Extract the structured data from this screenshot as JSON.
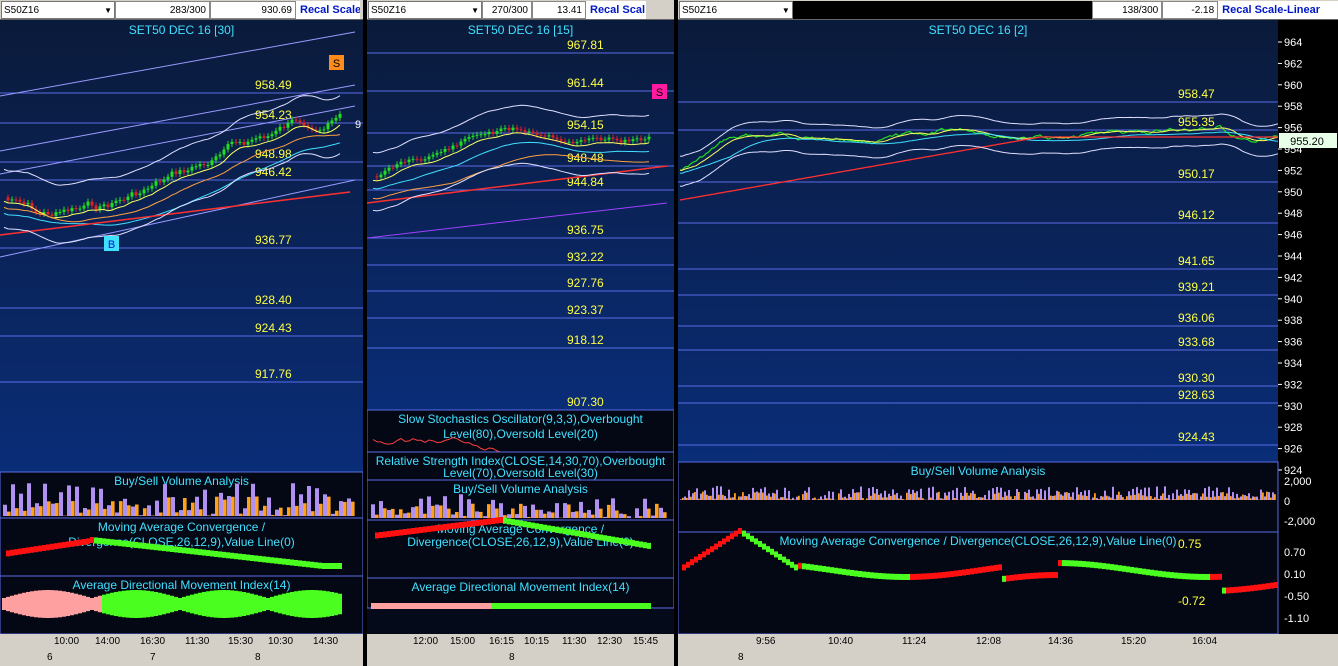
{
  "panels": [
    {
      "symbol": "S50Z16",
      "count": "283/300",
      "value": "930.69",
      "recal": "Recal Scale",
      "title": "SET50 DEC 16  [30]",
      "levels": [
        "958.49",
        "954.23",
        "948.98",
        "946.42",
        "936.77",
        "928.40",
        "924.43",
        "917.76"
      ],
      "right_tag": "9",
      "sell_marker": "S",
      "buy_marker": "B",
      "indicators": [
        "Buy/Sell Volume Analysis",
        "Moving Average Convergence /",
        "Divergence(CLOSE,26,12,9),Value Line(0)",
        "Average Directional Movement Index(14)"
      ],
      "times": [
        "10:00",
        "14:00",
        "16:30",
        "11:30",
        "15:30",
        "10:30",
        "14:30"
      ],
      "dates": [
        "6",
        "7",
        "8"
      ]
    },
    {
      "symbol": "S50Z16",
      "count": "270/300",
      "value": "13.41",
      "recal": "Recal Scal",
      "title": "SET50 DEC 16  [15]",
      "levels": [
        "967.81",
        "961.44",
        "954.15",
        "948.48",
        "944.84",
        "936.75",
        "932.22",
        "927.76",
        "923.37",
        "918.12",
        "907.30"
      ],
      "sell_marker": "S",
      "indicators": [
        "Slow Stochastics Oscillator(9,3,3),Overbought",
        "Level(80),Oversold Level(20)",
        "Relative Strength Index(CLOSE,14,30,70),Overbought",
        "Level(70),Oversold Level(30)",
        "Buy/Sell Volume Analysis",
        "Moving Average Convergence /",
        "Divergence(CLOSE,26,12,9),Value Line(0)",
        "Average Directional Movement Index(14)"
      ],
      "times": [
        "12:00",
        "15:00",
        "16:15",
        "10:15",
        "11:30",
        "12:30",
        "15:45"
      ],
      "dates": [
        "8"
      ]
    },
    {
      "symbol": "S50Z16",
      "count": "138/300",
      "value": "-2.18",
      "recal": "Recal Scale-Linear",
      "title": "SET50 DEC 16  [2]",
      "levels": [
        "958.47",
        "955.35",
        "950.17",
        "946.12",
        "941.65",
        "939.21",
        "936.06",
        "933.68",
        "930.30",
        "928.63",
        "924.43"
      ],
      "price_tag": "955.20",
      "price_axis": [
        "964",
        "962",
        "960",
        "958",
        "956",
        "954",
        "952",
        "950",
        "948",
        "946",
        "944",
        "942",
        "940",
        "938",
        "936",
        "934",
        "932",
        "930",
        "928",
        "926",
        "924"
      ],
      "vol_axis": [
        "2,000",
        "0",
        "-2,000"
      ],
      "macd_axis": [
        "0.70",
        "0.10",
        "-0.50",
        "-1.10"
      ],
      "macd_levels": [
        "0.75",
        "-0.72"
      ],
      "indicators": [
        "Buy/Sell Volume Analysis",
        "Moving Average Convergence / Divergence(CLOSE,26,12,9),Value Line(0)"
      ],
      "times": [
        "9:56",
        "10:40",
        "11:24",
        "12:08",
        "14:36",
        "15:20",
        "16:04"
      ],
      "dates": [
        "8"
      ]
    }
  ],
  "colors": {
    "bg_top": "#0a1a3a",
    "bg_bottom": "#0a2d78",
    "level_line": "#5a6ae6",
    "level_text": "#ffff40",
    "title_text": "#40e0ff",
    "up": "#22dd22",
    "down": "#dd2222",
    "sell_orange": "#ff8c1a",
    "sell_magenta": "#ff1aa0",
    "buy_cyan": "#40e0ff",
    "vol_purple": "#b090f0",
    "vol_orange": "#ffa020",
    "macd_green": "#4aff20",
    "macd_red": "#ff1010",
    "adx_pink": "#ffa0a0"
  }
}
